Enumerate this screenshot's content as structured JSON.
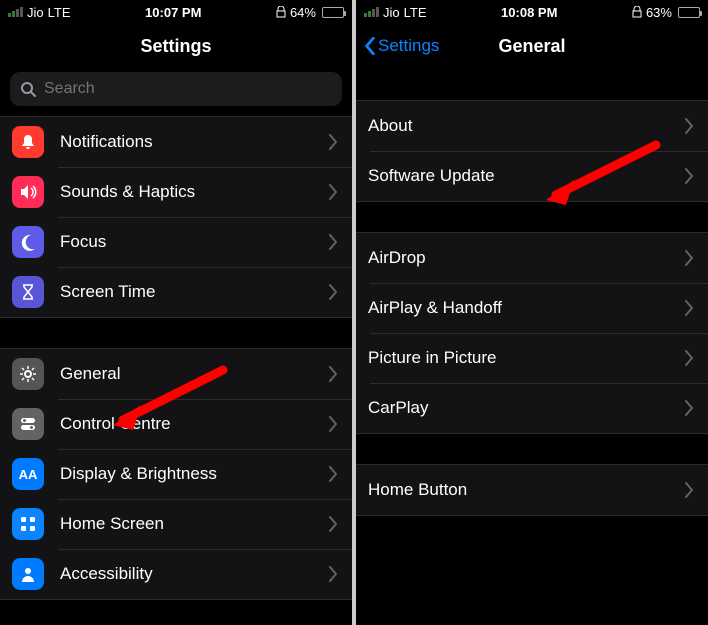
{
  "left": {
    "status": {
      "carrier": "Jio",
      "network": "LTE",
      "time": "10:07 PM",
      "battery_pct": "64%",
      "battery_level_pct": 64
    },
    "title": "Settings",
    "search": {
      "placeholder": "Search"
    },
    "groups": [
      [
        {
          "id": "notifications",
          "label": "Notifications",
          "icon": "bell",
          "bg": "bg-red"
        },
        {
          "id": "sounds",
          "label": "Sounds & Haptics",
          "icon": "speaker",
          "bg": "bg-pink"
        },
        {
          "id": "focus",
          "label": "Focus",
          "icon": "moon",
          "bg": "bg-indigo"
        },
        {
          "id": "screentime",
          "label": "Screen Time",
          "icon": "hourglass",
          "bg": "bg-purple"
        }
      ],
      [
        {
          "id": "general",
          "label": "General",
          "icon": "gear",
          "bg": "bg-gray"
        },
        {
          "id": "controlcentre",
          "label": "Control Centre",
          "icon": "switches",
          "bg": "bg-gray2"
        },
        {
          "id": "display",
          "label": "Display & Brightness",
          "icon": "aa",
          "bg": "bg-blue"
        },
        {
          "id": "homescreen",
          "label": "Home Screen",
          "icon": "grid",
          "bg": "bg-blue2"
        },
        {
          "id": "accessibility",
          "label": "Accessibility",
          "icon": "person",
          "bg": "bg-blue"
        }
      ]
    ]
  },
  "right": {
    "status": {
      "carrier": "Jio",
      "network": "LTE",
      "time": "10:08 PM",
      "battery_pct": "63%",
      "battery_level_pct": 63
    },
    "back": "Settings",
    "title": "General",
    "groups": [
      [
        {
          "id": "about",
          "label": "About"
        },
        {
          "id": "swupdate",
          "label": "Software Update"
        }
      ],
      [
        {
          "id": "airdrop",
          "label": "AirDrop"
        },
        {
          "id": "airplay",
          "label": "AirPlay & Handoff"
        },
        {
          "id": "pip",
          "label": "Picture in Picture"
        },
        {
          "id": "carplay",
          "label": "CarPlay"
        }
      ],
      [
        {
          "id": "homebutton",
          "label": "Home Button"
        }
      ]
    ]
  }
}
